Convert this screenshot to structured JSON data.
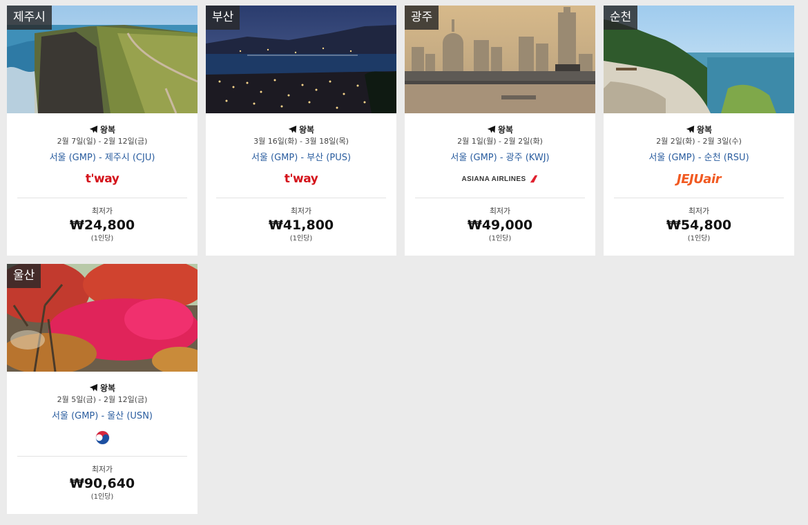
{
  "deals": [
    {
      "city": "제주시",
      "trip": "왕복",
      "dates": "2월 7일(일) - 2월 12일(금)",
      "route": "서울 (GMP) - 제주시 (CJU)",
      "airline_name": "t'way",
      "price_label": "최저가",
      "price": "₩24,800",
      "per_person": "(1인당)"
    },
    {
      "city": "부산",
      "trip": "왕복",
      "dates": "3월 16일(화) - 3월 18일(목)",
      "route": "서울 (GMP) - 부산 (PUS)",
      "airline_name": "t'way",
      "price_label": "최저가",
      "price": "₩41,800",
      "per_person": "(1인당)"
    },
    {
      "city": "광주",
      "trip": "왕복",
      "dates": "2월 1일(월) - 2월 2일(화)",
      "route": "서울 (GMP) - 광주 (KWJ)",
      "airline_name": "ASIANA AIRLINES",
      "price_label": "최저가",
      "price": "₩49,000",
      "per_person": "(1인당)"
    },
    {
      "city": "순천",
      "trip": "왕복",
      "dates": "2월 2일(화) - 2월 3일(수)",
      "route": "서울 (GMP) - 순천 (RSU)",
      "airline_name": "JEJUair",
      "price_label": "최저가",
      "price": "₩54,800",
      "per_person": "(1인당)"
    },
    {
      "city": "울산",
      "trip": "왕복",
      "dates": "2월 5일(금) - 2월 12일(금)",
      "route": "서울 (GMP) - 울산 (USN)",
      "airline_name": "Korean Air",
      "price_label": "최저가",
      "price": "₩90,640",
      "per_person": "(1인당)"
    }
  ],
  "colors": {
    "background": "#ebebeb",
    "route_link": "#2a5d9f",
    "tway_red": "#d4131b",
    "jeju_orange": "#f15a22",
    "asiana_red": "#e0202e",
    "korean_air_blue": "#1c4fa1"
  }
}
